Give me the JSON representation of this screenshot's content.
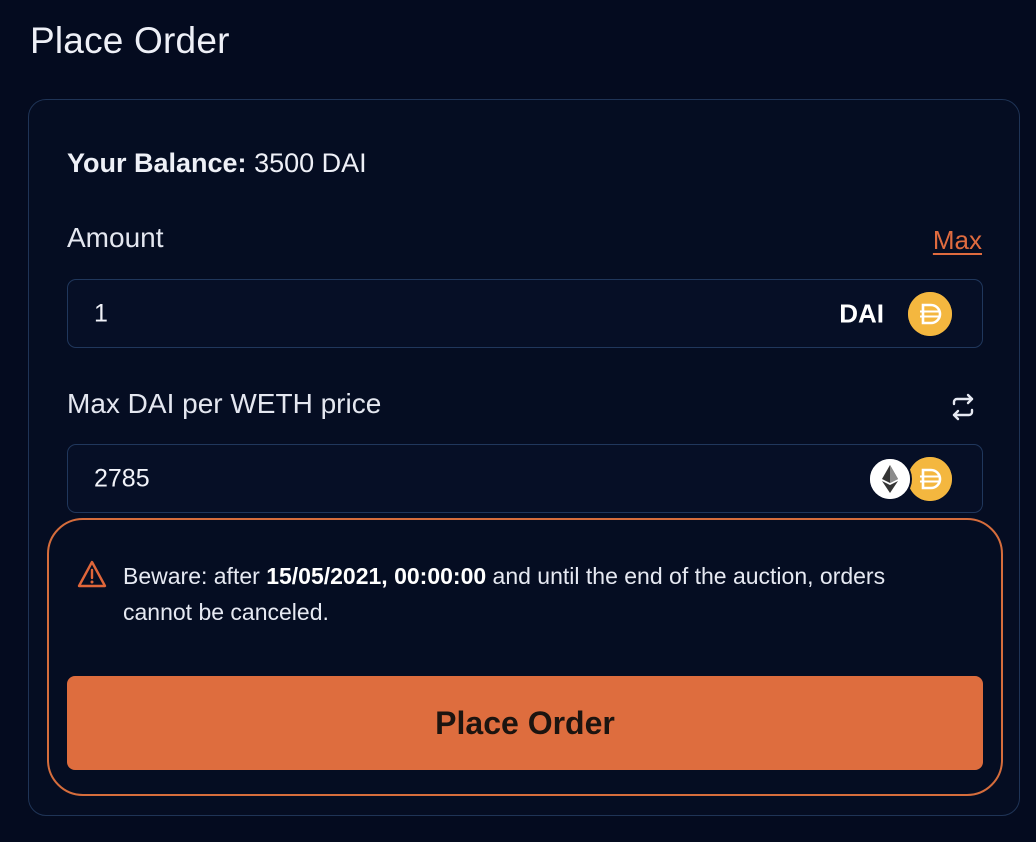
{
  "page": {
    "title": "Place Order"
  },
  "balance": {
    "label": "Your Balance:",
    "value": "3500 DAI"
  },
  "amount": {
    "label": "Amount",
    "max_label": "Max",
    "value": "1",
    "token": "DAI",
    "token_icon": "dai-coin-icon"
  },
  "price": {
    "label": "Max DAI per WETH price",
    "value": "2785",
    "swap_icon": "swap-icon",
    "token_icons": [
      "eth-coin-icon",
      "dai-coin-icon"
    ]
  },
  "warning": {
    "prefix": "Beware: after ",
    "date": "15/05/2021, 00:00:00",
    "suffix": " and until the end of the auction, orders cannot be canceled."
  },
  "submit": {
    "label": "Place Order"
  },
  "colors": {
    "background": "#040b1f",
    "accent": "#de6d3e",
    "dai": "#f4b73f",
    "border": "#1f3456"
  }
}
